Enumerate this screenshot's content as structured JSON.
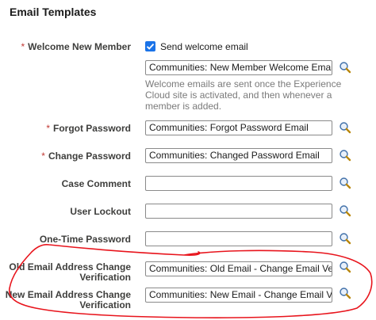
{
  "section_title": "Email Templates",
  "welcome": {
    "label": "Welcome New Member",
    "required": "*",
    "checkbox_label": "Send welcome email",
    "checked": true,
    "value": "Communities: New Member Welcome Email",
    "help_text": "Welcome emails are sent once the Experience Cloud site is activated, and then whenever a member is added."
  },
  "fields": [
    {
      "label": "Forgot Password",
      "required": "*",
      "value": "Communities: Forgot Password Email"
    },
    {
      "label": "Change Password",
      "required": "*",
      "value": "Communities: Changed Password Email"
    },
    {
      "label": "Case Comment",
      "required": "",
      "value": ""
    },
    {
      "label": "User Lockout",
      "required": "",
      "value": ""
    },
    {
      "label": "One-Time Password",
      "required": "",
      "value": ""
    },
    {
      "label_line1": "Old Email Address Change",
      "label_line2": "Verification",
      "required": "",
      "value": "Communities: Old Email - Change Email Verification"
    },
    {
      "label_line1": "New Email Address Change",
      "label_line2": "Verification",
      "required": "",
      "value": "Communities: New Email - Change Email Verification"
    }
  ],
  "icons": {
    "lookup": "magnifier-lookup-icon",
    "checkbox": "checkbox-checked-icon"
  },
  "colors": {
    "checkbox": "#1a73e8",
    "required": "#c23934",
    "annotation": "#e8141c"
  }
}
